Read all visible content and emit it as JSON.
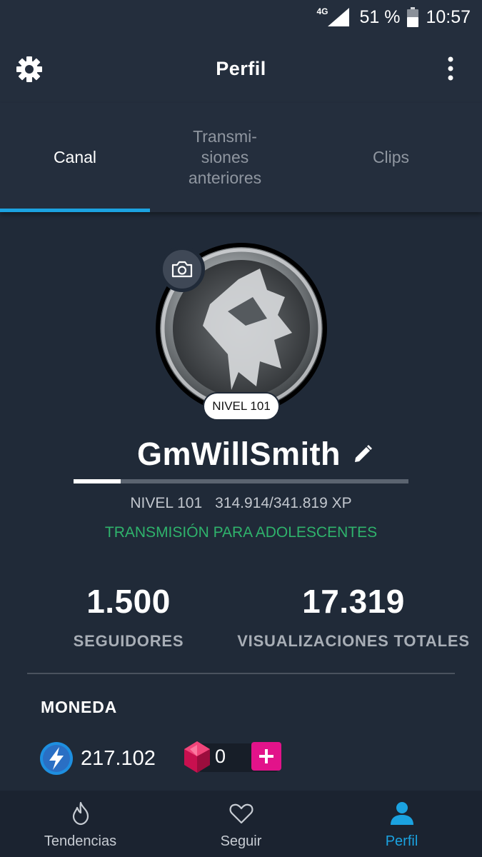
{
  "status_bar": {
    "network": "4G",
    "battery_percent": "51 %",
    "time": "10:57",
    "icons": [
      "signal-icon",
      "battery-icon"
    ]
  },
  "app_bar": {
    "title": "Perfil",
    "left_icon": "gear-icon",
    "right_icon": "more-vert-icon"
  },
  "tabs": [
    {
      "label": "Canal",
      "active": true
    },
    {
      "label": "Transmi-\nsiones\nanteriores",
      "active": false
    },
    {
      "label": "Clips",
      "active": false
    }
  ],
  "profile": {
    "level_badge": "NIVEL 101",
    "username": "GmWillSmith",
    "xp_progress": 0.14,
    "level_text": "NIVEL 101",
    "xp_text": "314.914/341.819 XP",
    "rating": "TRANSMISIÓN PARA ADOLESCENTES"
  },
  "stats": {
    "followers": {
      "value": "1.500",
      "label": "SEGUIDORES"
    },
    "views": {
      "value": "17.319",
      "label": "VISUALIZACIONES TOTALES"
    }
  },
  "currency": {
    "title": "MONEDA",
    "bits": "217.102",
    "gems": "0",
    "add_label": "+"
  },
  "bottom_nav": [
    {
      "label": "Tendencias",
      "icon": "flame-icon",
      "active": false
    },
    {
      "label": "Seguir",
      "icon": "heart-icon",
      "active": false
    },
    {
      "label": "Perfil",
      "icon": "person-icon",
      "active": true
    }
  ],
  "colors": {
    "accent": "#1ba2e0",
    "rating_green": "#2fb36c",
    "gem_button": "#e2138a",
    "background": "#242e3d"
  }
}
